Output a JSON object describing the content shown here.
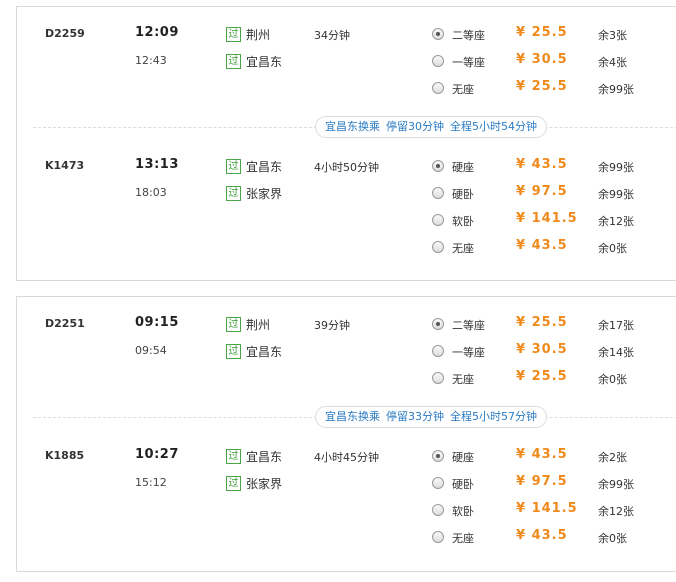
{
  "journeys": [
    {
      "legs": [
        {
          "train_no": "D2259",
          "dep_time": "12:09",
          "arr_time": "12:43",
          "pass_label": "过",
          "from": "荆州",
          "to": "宜昌东",
          "duration": "34分钟",
          "seats": [
            {
              "type": "二等座",
              "price": "¥ 25.5",
              "remain": "余3张",
              "checked": true
            },
            {
              "type": "一等座",
              "price": "¥ 30.5",
              "remain": "余4张",
              "checked": false
            },
            {
              "type": "无座",
              "price": "¥ 25.5",
              "remain": "余99张",
              "checked": false
            }
          ]
        },
        {
          "train_no": "K1473",
          "dep_time": "13:13",
          "arr_time": "18:03",
          "pass_label": "过",
          "from": "宜昌东",
          "to": "张家界",
          "duration": "4小时50分钟",
          "seats": [
            {
              "type": "硬座",
              "price": "¥ 43.5",
              "remain": "余99张",
              "checked": true
            },
            {
              "type": "硬卧",
              "price": "¥ 97.5",
              "remain": "余99张",
              "checked": false
            },
            {
              "type": "软卧",
              "price": "¥ 141.5",
              "remain": "余12张",
              "checked": false
            },
            {
              "type": "无座",
              "price": "¥ 43.5",
              "remain": "余0张",
              "checked": false
            }
          ]
        }
      ],
      "transfer": {
        "station": "宜昌东换乘",
        "stay": "停留30分钟",
        "total": "全程5小时54分钟"
      }
    },
    {
      "legs": [
        {
          "train_no": "D2251",
          "dep_time": "09:15",
          "arr_time": "09:54",
          "pass_label": "过",
          "from": "荆州",
          "to": "宜昌东",
          "duration": "39分钟",
          "seats": [
            {
              "type": "二等座",
              "price": "¥ 25.5",
              "remain": "余17张",
              "checked": true
            },
            {
              "type": "一等座",
              "price": "¥ 30.5",
              "remain": "余14张",
              "checked": false
            },
            {
              "type": "无座",
              "price": "¥ 25.5",
              "remain": "余0张",
              "checked": false
            }
          ]
        },
        {
          "train_no": "K1885",
          "dep_time": "10:27",
          "arr_time": "15:12",
          "pass_label": "过",
          "from": "宜昌东",
          "to": "张家界",
          "duration": "4小时45分钟",
          "seats": [
            {
              "type": "硬座",
              "price": "¥ 43.5",
              "remain": "余2张",
              "checked": true
            },
            {
              "type": "硬卧",
              "price": "¥ 97.5",
              "remain": "余99张",
              "checked": false
            },
            {
              "type": "软卧",
              "price": "¥ 141.5",
              "remain": "余12张",
              "checked": false
            },
            {
              "type": "无座",
              "price": "¥ 43.5",
              "remain": "余0张",
              "checked": false
            }
          ]
        }
      ],
      "transfer": {
        "station": "宜昌东换乘",
        "stay": "停留33分钟",
        "total": "全程5小时57分钟"
      }
    }
  ],
  "colors": {
    "price": "#f08a1c",
    "transfer_text": "#2a7bc4",
    "pass_badge": "#3a9a36"
  }
}
